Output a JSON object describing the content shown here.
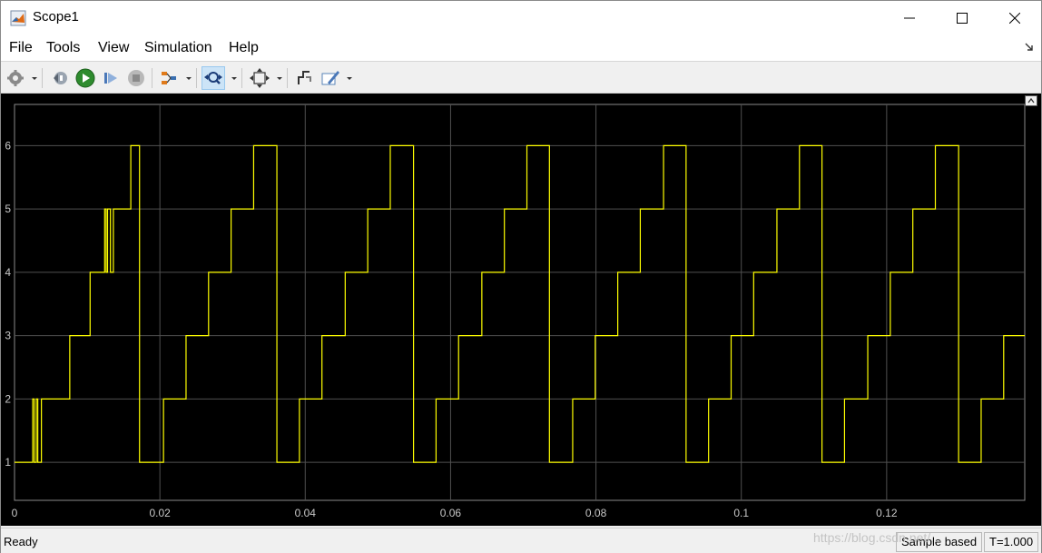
{
  "window": {
    "title": "Scope1"
  },
  "menu": {
    "items": [
      "File",
      "Tools",
      "View",
      "Simulation",
      "Help"
    ]
  },
  "toolbar": {
    "icons": [
      "gear-icon",
      "step-back-icon",
      "run-icon",
      "step-forward-icon",
      "stop-icon",
      "signal-routing-icon",
      "zoom-icon",
      "fit-axes-icon",
      "cursor-measure-icon",
      "style-pen-icon"
    ]
  },
  "colors": {
    "plot_bg": "#000000",
    "signal": "#ffff00",
    "grid": "#505050",
    "tick_text": "#c8c8c8"
  },
  "chart_data": {
    "type": "line",
    "title": "",
    "xlabel": "",
    "ylabel": "",
    "xlim": [
      0,
      0.139
    ],
    "ylim": [
      0.4,
      6.65
    ],
    "grid": true,
    "xticks": [
      "0",
      "0.02",
      "0.04",
      "0.06",
      "0.08",
      "0.1",
      "0.12"
    ],
    "yticks": [
      "1",
      "2",
      "3",
      "4",
      "5",
      "6"
    ],
    "series": [
      {
        "x": [
          0,
          0.0025,
          0.0027,
          0.003,
          0.0032,
          0.0037,
          0.0039,
          0.0076,
          0.0104,
          0.0124,
          0.0126,
          0.0128,
          0.0132,
          0.0136,
          0.016,
          0.0172,
          0.0205,
          0.0236,
          0.0267,
          0.0298,
          0.0329,
          0.0361,
          0.0392,
          0.0423,
          0.0455,
          0.0486,
          0.0517,
          0.0549,
          0.058,
          0.0611,
          0.0643,
          0.0674,
          0.0705,
          0.0736,
          0.0768,
          0.0799,
          0.083,
          0.0861,
          0.0893,
          0.0924,
          0.0955,
          0.0986,
          0.1017,
          0.1049,
          0.108,
          0.1111,
          0.1142,
          0.1174,
          0.1205,
          0.1236,
          0.1267,
          0.1299,
          0.133,
          0.1361,
          0.139
        ],
        "y": [
          1,
          2,
          1,
          2,
          1,
          2,
          2,
          3,
          4,
          5,
          4,
          5,
          4,
          5,
          6,
          1,
          2,
          3,
          4,
          5,
          6,
          1,
          2,
          3,
          4,
          5,
          6,
          1,
          2,
          3,
          4,
          5,
          6,
          1,
          2,
          3,
          4,
          5,
          6,
          1,
          2,
          3,
          4,
          5,
          6,
          1,
          2,
          3,
          4,
          5,
          6,
          1,
          2,
          3,
          3
        ]
      }
    ]
  },
  "status": {
    "state": "Ready",
    "mode": "Sample based",
    "time": "T=1.000"
  },
  "watermark": "https://blog.csdn.net/..."
}
